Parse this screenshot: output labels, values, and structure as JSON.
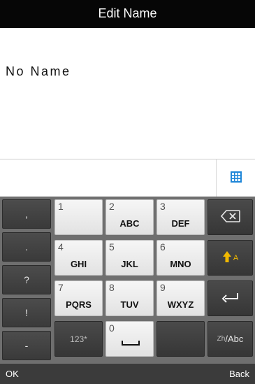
{
  "header": {
    "title": "Edit Name"
  },
  "name": {
    "value": "No Name"
  },
  "input": {
    "grid_icon": "grid-icon"
  },
  "symbols": [
    ",",
    ".",
    "?",
    "!",
    "-"
  ],
  "keys": [
    {
      "digit": "1",
      "letters": ""
    },
    {
      "digit": "2",
      "letters": "ABC"
    },
    {
      "digit": "3",
      "letters": "DEF"
    },
    {
      "digit": "4",
      "letters": "GHI"
    },
    {
      "digit": "5",
      "letters": "JKL"
    },
    {
      "digit": "6",
      "letters": "MNO"
    },
    {
      "digit": "7",
      "letters": "PQRS"
    },
    {
      "digit": "8",
      "letters": "TUV"
    },
    {
      "digit": "9",
      "letters": "WXYZ"
    },
    {
      "digit": "0",
      "letters": ""
    }
  ],
  "mode_key": {
    "label": "123*"
  },
  "lang_key": {
    "small": "Zh",
    "label": "/Abc"
  },
  "icons": {
    "backspace": "backspace-icon",
    "shift": "shift-icon",
    "enter": "enter-icon",
    "space": "space-icon"
  },
  "shift_key": {
    "label": "A"
  },
  "softkeys": {
    "left": "OK",
    "right": "Back"
  },
  "colors": {
    "accent": "#f0b800",
    "grid_icon": "#1e86d8"
  }
}
